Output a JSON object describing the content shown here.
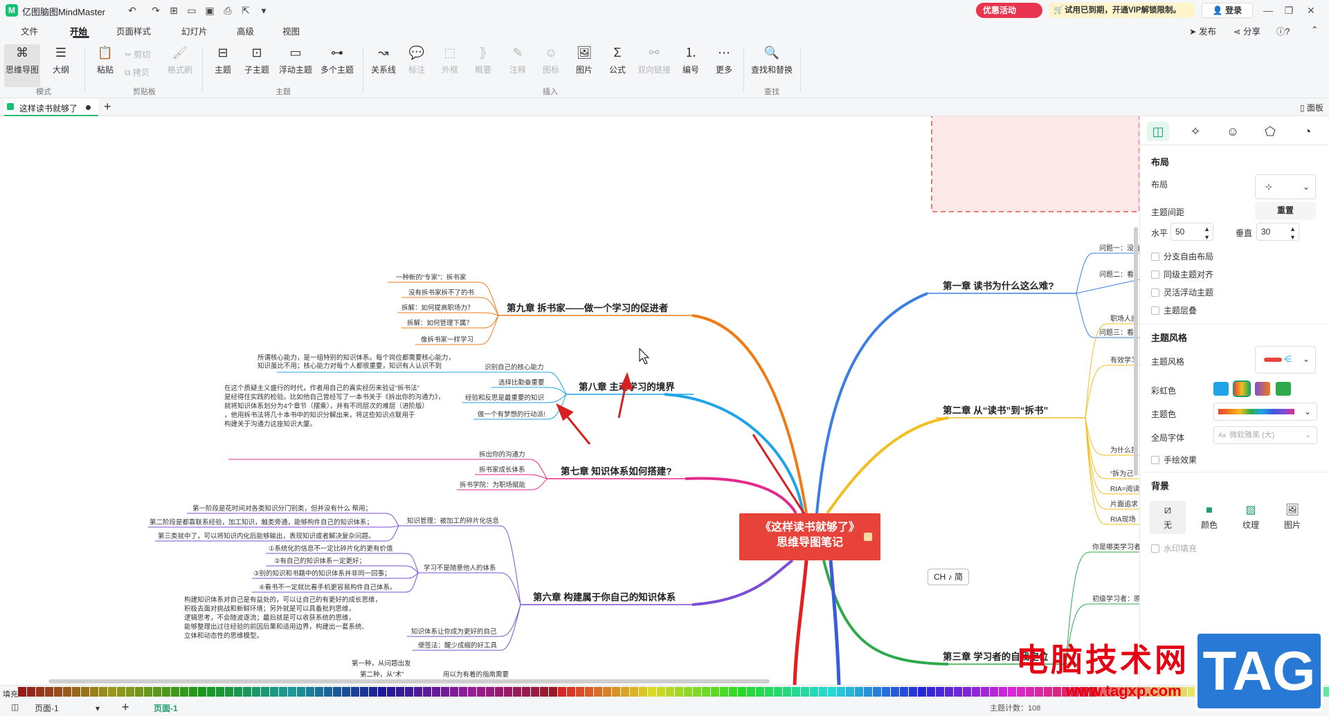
{
  "app": {
    "name": "亿图脑图MindMaster",
    "logo": "M"
  },
  "titlebar": {
    "promo": "优惠活动",
    "trial": "试用已到期，开通VIP解锁限制。",
    "login": "登录",
    "quick_icons": [
      "undo-icon",
      "redo-icon",
      "new-icon",
      "open-icon",
      "save-icon",
      "print-icon",
      "export-icon",
      "more-icon"
    ]
  },
  "menu": {
    "tabs": [
      "文件",
      "开始",
      "页面样式",
      "幻灯片",
      "高级",
      "视图"
    ],
    "active": "开始",
    "publish": "发布",
    "share": "分享",
    "help": "?"
  },
  "ribbon": {
    "mindmap": "思维导图",
    "outline": "大纲",
    "group_mode": "模式",
    "paste": "粘贴",
    "cut": "剪切",
    "copy": "拷贝",
    "format_painter": "格式刷",
    "group_clipboard": "剪贴板",
    "topic": "主题",
    "subtopic": "子主题",
    "float_topic": "浮动主题",
    "multi_topic": "多个主题",
    "group_topic": "主题",
    "relation": "关系线",
    "callout": "标注",
    "boundary": "外框",
    "summary": "概要",
    "note": "注释",
    "icon": "图标",
    "image": "图片",
    "formula": "公式",
    "bilink": "双向链接",
    "numbering": "编号",
    "more": "更多",
    "group_insert": "插入",
    "find_replace": "查找和替换",
    "group_find": "查找"
  },
  "tabbar": {
    "doc_title": "这样读书就够了",
    "new_tab": "+",
    "panel": "面板"
  },
  "mindmap": {
    "central_line1": "《这样读书就够了》",
    "central_line2": "思维导图笔记",
    "ch1": {
      "title": "第一章 读书为什么这么难?",
      "subs": [
        "问题一：没有",
        "问题二：看",
        "问题三：看"
      ]
    },
    "ch2": {
      "title": "第二章 从“读书”到“拆书”",
      "subs": [
        "职场人应",
        "有效学习",
        "为什么拆",
        "“拆为己",
        "RIA=阅读",
        "片面追求",
        "RIA现场"
      ]
    },
    "ch3": {
      "title": "第三章 学习者的自我定位",
      "subs": [
        "你是哪类学习者",
        "初级学习者：原"
      ]
    },
    "ch9": {
      "title": "第九章 拆书家——做一个学习的促进者",
      "subs": [
        "一种新的“专家”：拆书家",
        "没有拆书家拆不了的书",
        "拆解：如何提高职场力？",
        "拆解：如何管理下属？",
        "像拆书家一样学习"
      ]
    },
    "ch8": {
      "title": "第八章 主动学习的境界",
      "subs": [
        "识别自己的核心能力",
        "选择比勤奋重要",
        "经验和反思是最重要的知识",
        "做一个有梦想的行动派!"
      ],
      "note1": "所谓核心能力，是一组特别的知识体系。每个岗位都需要核心能力，",
      "note2": "知识虽比不用；核心能力对每个人都很重要，知识有人认识不到"
    },
    "ch7": {
      "title": "第七章 知识体系如何搭建?",
      "subs": [
        "拆出你的沟通力",
        "拆书家成长体系",
        "拆书学院：为职场赋能"
      ],
      "note": [
        "在这个质疑主义盛行的时代，作者用自己的真实经历来验证“拆书法”",
        "是经得住实践的检验。比如他自己曾经写了一本书关于《拆出你的沟通力》，",
        "就将知识体系划分为4个章节（摆乘），并有不同层次的难层（进阶版）",
        "，他用拆书法将几十本书中的知识分解出来，将这些知识点联用于",
        "构建关于沟通力这座知识大厦。"
      ]
    },
    "ch6": {
      "title": "第六章 构建属于你自己的知识体系",
      "subs": [
        "知识管理：被加工的碎片化信息",
        "学习不是随意他人的体系",
        "知识体系让你成为更好的自己",
        "便签法：醒少成缩的好工具"
      ],
      "km_notes": [
        "第一阶段是花时间对各类知识分门别类，但并没有什么 帮用；",
        "第二阶段是都靠联系经验，加工知识，触类旁通，能够构件自己的知识体系；",
        "第三类就中了，可以将知识内化后能够输出，表现知识或者解决复杂问题。"
      ],
      "learn_notes": [
        "①系统化的信息不一定比碎片化的更有价值",
        "②有自己的知识体系一定更好；",
        "③别的知识和书籍中的知识体系并非同一回事；",
        "④看书不一定就比看手机更容易构件自己体系。"
      ],
      "sys_note": [
        "构建知识体系对自己是有益处的，可以让自己的有更好的成长思维，",
        "积极去面对挑战和新鲜环境；另外就是可以具备批判思维，",
        "逻辑思考，不会随波逐流；最后就是可以收获系统的思维，",
        "能够整理出过往经验的前因后果和适用边界，构建出一套系统、",
        "立体和动态性的思维模型。"
      ],
      "memo_notes": [
        "第一种，从问题出发",
        "第二种，从“术”"
      ]
    },
    "cutoff": [
      "用以为有着的指南需要"
    ]
  },
  "panel": {
    "tabs": [
      "layout-tab-icon",
      "ai-sparkle-icon",
      "marker-icon",
      "theme-icon",
      "history-icon"
    ],
    "layout_section": "布局",
    "layout_label": "布局",
    "topic_spacing": "主题间距",
    "reset": "重置",
    "horizontal": "水平",
    "h_value": "50",
    "vertical": "垂直",
    "v_value": "30",
    "checks": [
      "分支自由布局",
      "同级主题对齐",
      "灵活浮动主题",
      "主题层叠"
    ],
    "style_section": "主题风格",
    "style_label": "主题风格",
    "rainbow": "彩虹色",
    "theme_color": "主题色",
    "font_label": "全局字体",
    "font_value": "微软雅黑 (大)",
    "hand_drawn": "手绘效果",
    "bg_section": "背景",
    "bg_options": [
      "无",
      "颜色",
      "纹理",
      "图片"
    ],
    "watermark": "水印填充"
  },
  "status": {
    "fill": "填充",
    "page": "页面-1",
    "page_tab": "页面-1",
    "topic_count": "主题计数：108",
    "ime": "CH ♪ 简"
  },
  "colors": {
    "accent": "#1b9e6c",
    "central": "#e8433b",
    "ch1": "#3c7ee6",
    "ch2": "#f2bf20",
    "ch3": "#2eaa4c",
    "ch6": "#7a4fd6",
    "ch7": "#e22b8c",
    "ch8": "#1fa4e8",
    "ch9": "#f07b15",
    "arrow": "#d92020"
  },
  "watermark": {
    "text": "电脑技术网",
    "url": "www.tagxp.com",
    "tag": "TAG"
  }
}
